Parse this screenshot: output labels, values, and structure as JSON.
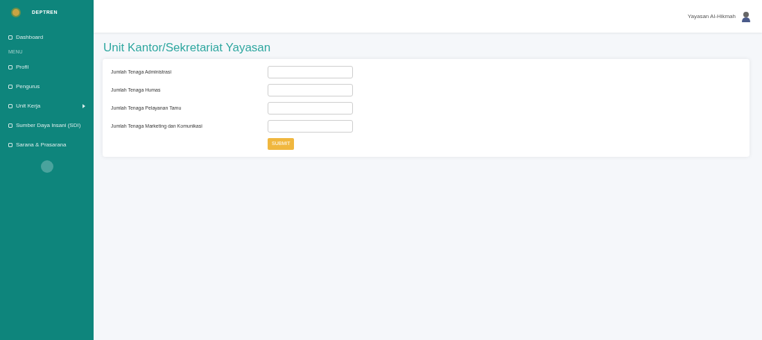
{
  "brand": "DEPTREN",
  "sidebar": {
    "items": [
      {
        "kind": "link",
        "label": "Dashboard",
        "has_submenu": false
      },
      {
        "kind": "heading",
        "label": "MENU"
      },
      {
        "kind": "link",
        "label": "Profil",
        "has_submenu": false
      },
      {
        "kind": "link",
        "label": "Pengurus",
        "has_submenu": false
      },
      {
        "kind": "link",
        "label": "Unit Kerja",
        "has_submenu": true
      },
      {
        "kind": "link",
        "label": "Sumber Daya Insani (SDI)",
        "has_submenu": false
      },
      {
        "kind": "link",
        "label": "Sarana & Prasarana",
        "has_submenu": false
      }
    ]
  },
  "user": {
    "name": "Yayasan Al-Hikmah"
  },
  "page_title": "Unit Kantor/Sekretariat Yayasan",
  "form": {
    "fields": [
      {
        "label": "Jumlah Tenaga Administrasi"
      },
      {
        "label": "Jumlah Tenaga Humas"
      },
      {
        "label": "Jumlah Tenaga Pelayanan Tamu"
      },
      {
        "label": "Jumlah Tenaga Marketing dan Komunikasi"
      }
    ],
    "submit": "SUBMIT"
  }
}
